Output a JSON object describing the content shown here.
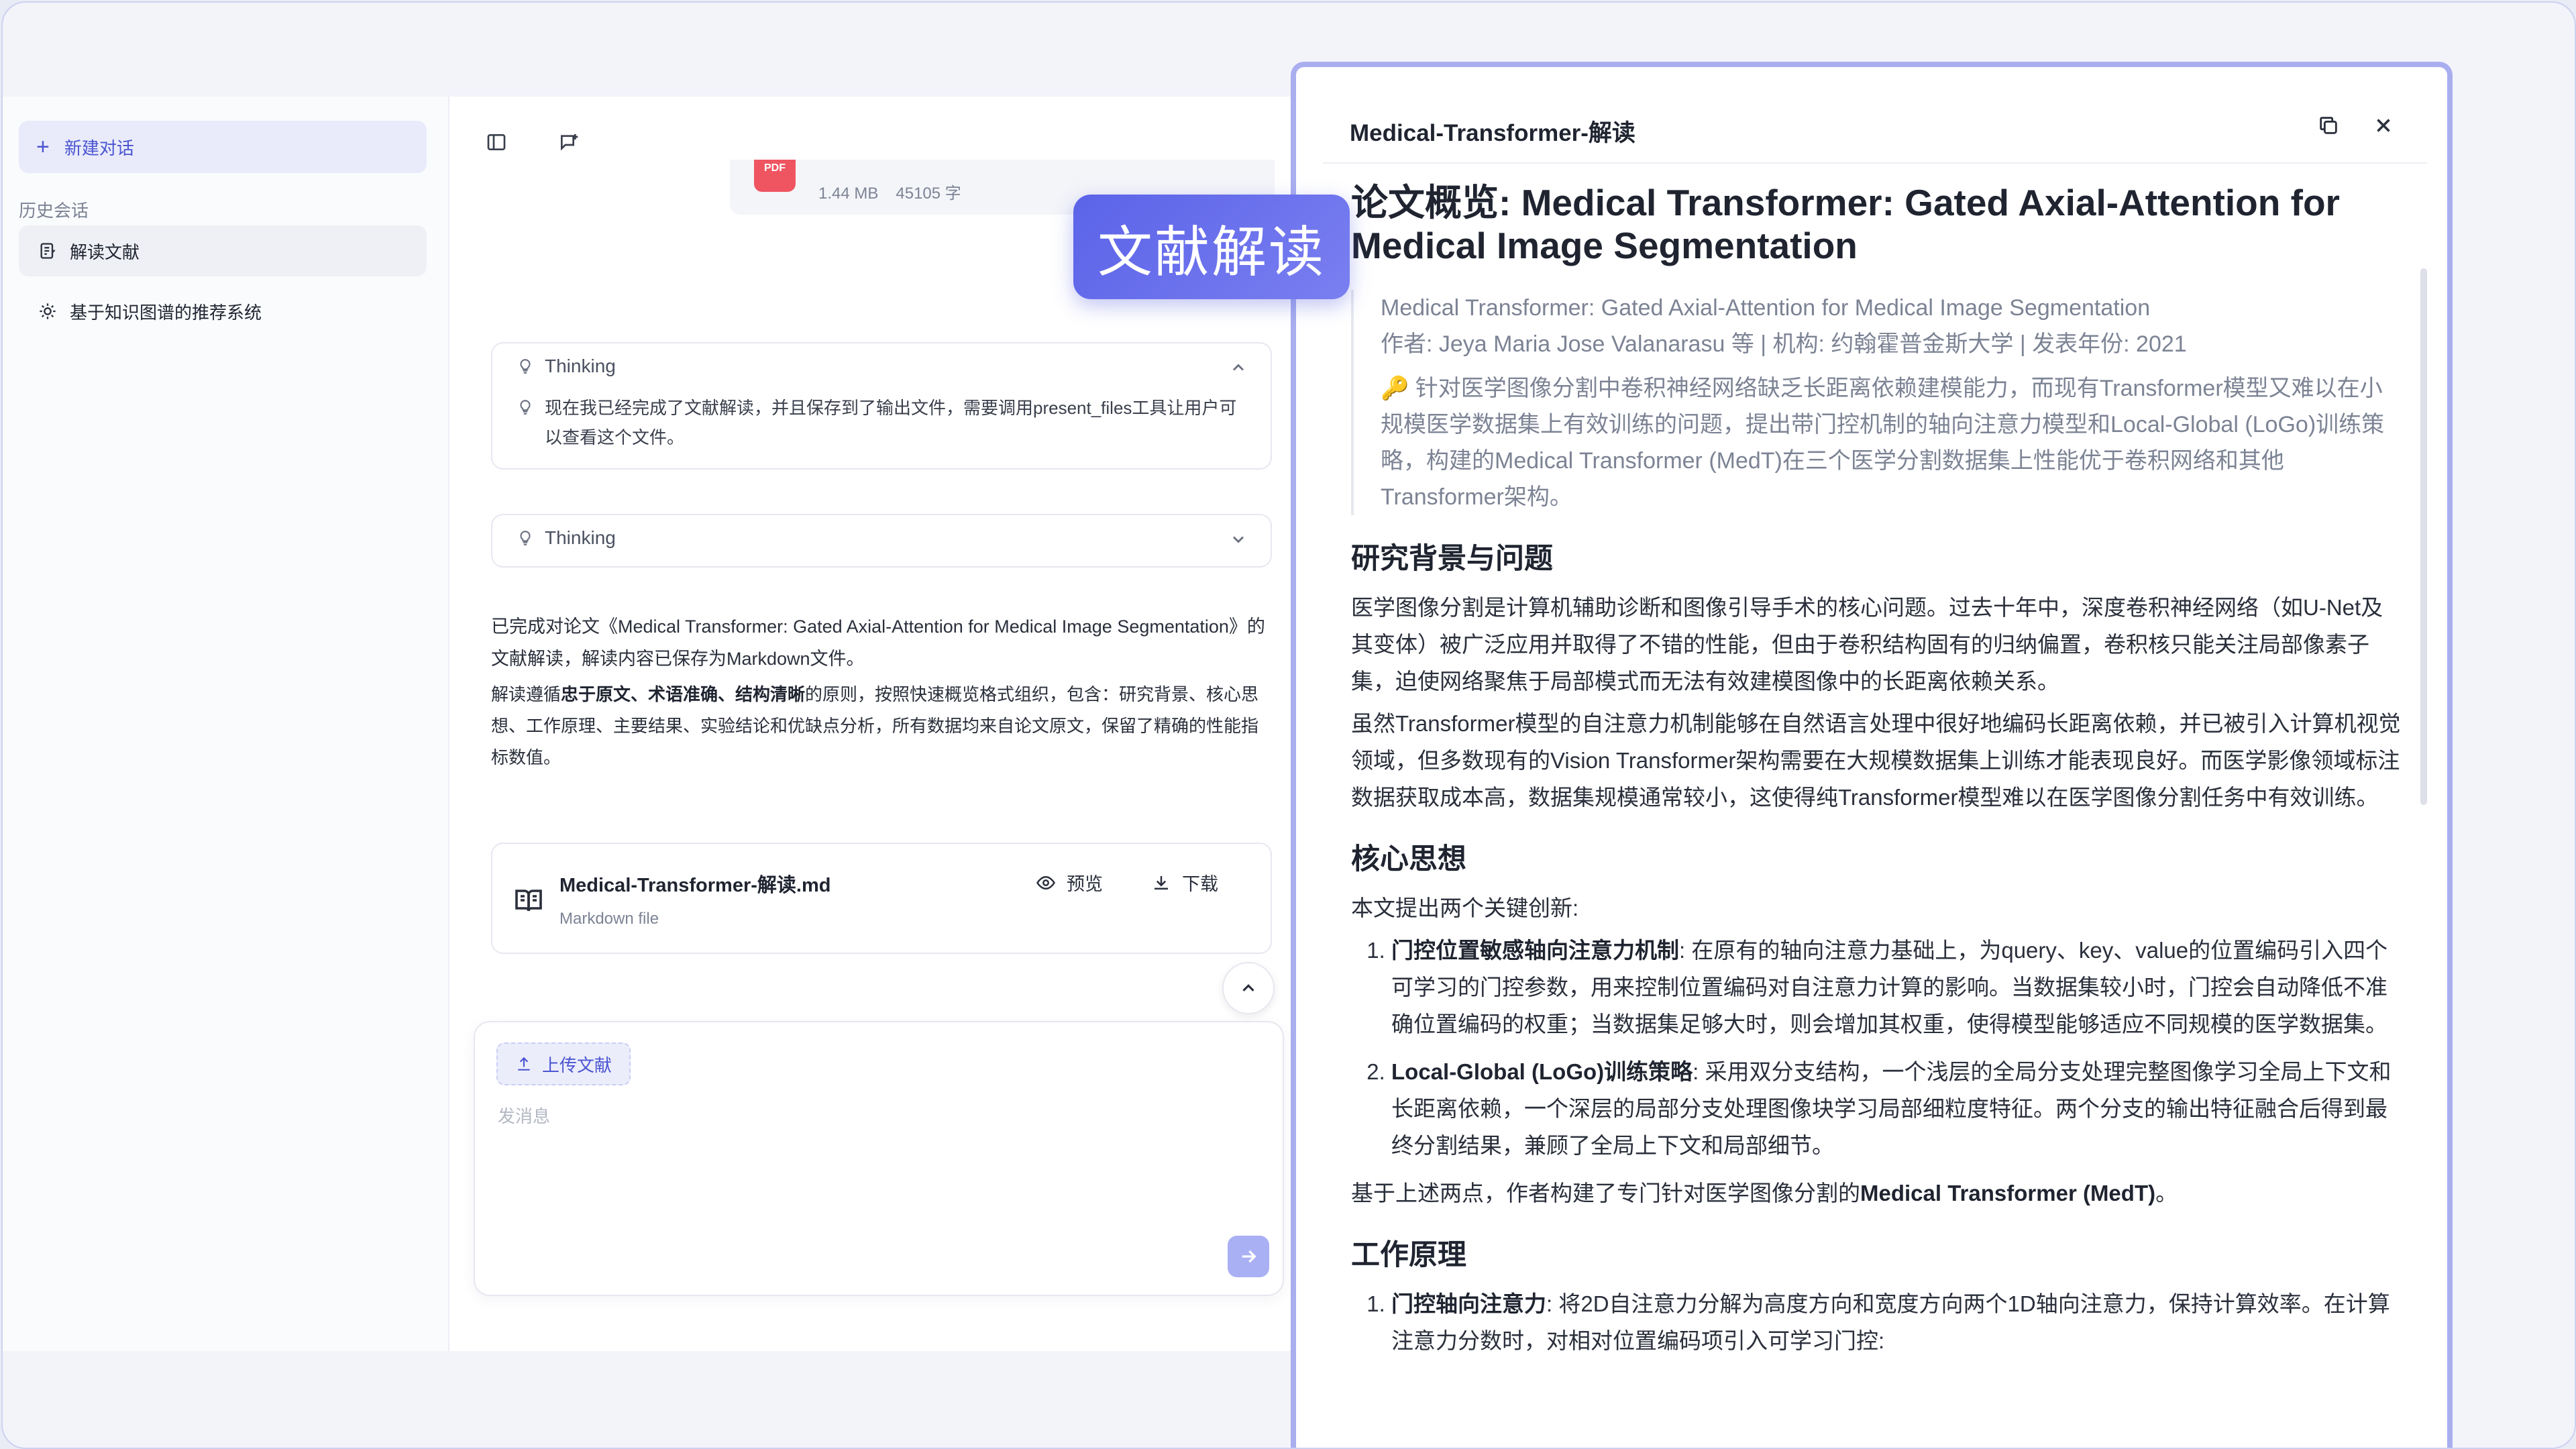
{
  "sidebar": {
    "new_chat": "新建对话",
    "history_label": "历史会话",
    "items": [
      {
        "label": "解读文献",
        "icon": "document-edit-icon"
      },
      {
        "label": "基于知识图谱的推荐系统",
        "icon": "sun-icon"
      }
    ]
  },
  "chat": {
    "attached_file": {
      "badge": "PDF",
      "size": "1.44 MB",
      "chars": "45105 字"
    },
    "thinking_1": {
      "label": "Thinking",
      "text": "现在我已经完成了文献解读，并且保存到了输出文件，需要调用present_files工具让用户可以查看这个文件。"
    },
    "thinking_2": {
      "label": "Thinking"
    },
    "summary_1": "已完成对论文《Medical Transformer: Gated Axial-Attention for Medical Image Segmentation》的文献解读，解读内容已保存为Markdown文件。",
    "summary_2_pre": "解读遵循",
    "summary_2_b1": "忠于原文、术语准确、结构清晰",
    "summary_2_post": "的原则，按照快速概览格式组织，包含：研究背景、核心思想、工作原理、主要结果、实验结论和优缺点分析，所有数据均来自论文原文，保留了精确的性能指标数值。",
    "file_card": {
      "name": "Medical-Transformer-解读.md",
      "type": "Markdown file",
      "preview": "预览",
      "download": "下载"
    },
    "composer": {
      "upload": "上传文献",
      "placeholder": "发消息"
    }
  },
  "badge": "文献解读",
  "panel": {
    "title": "Medical-Transformer-解读",
    "doc_title": "论文概览: Medical Transformer: Gated Axial-Attention for Medical Image Segmentation",
    "quote_title": "Medical Transformer: Gated Axial-Attention for Medical Image Segmentation",
    "quote_meta": "作者: Jeya Maria Jose Valanarasu 等 | 机构: 约翰霍普金斯大学 | 发表年份: 2021",
    "quote_summary": "🔑 针对医学图像分割中卷积神经网络缺乏长距离依赖建模能力，而现有Transformer模型又难以在小规模医学数据集上有效训练的问题，提出带门控机制的轴向注意力模型和Local-Global (LoGo)训练策略，构建的Medical Transformer (MedT)在三个医学分割数据集上性能优于卷积网络和其他Transformer架构。",
    "sections": {
      "background": {
        "heading": "研究背景与问题",
        "p1": "医学图像分割是计算机辅助诊断和图像引导手术的核心问题。过去十年中，深度卷积神经网络（如U-Net及其变体）被广泛应用并取得了不错的性能，但由于卷积结构固有的归纳偏置，卷积核只能关注局部像素子集，迫使网络聚焦于局部模式而无法有效建模图像中的长距离依赖关系。",
        "p2": "虽然Transformer模型的自注意力机制能够在自然语言处理中很好地编码长距离依赖，并已被引入计算机视觉领域，但多数现有的Vision Transformer架构需要在大规模数据集上训练才能表现良好。而医学影像领域标注数据获取成本高，数据集规模通常较小，这使得纯Transformer模型难以在医学图像分割任务中有效训练。"
      },
      "core": {
        "heading": "核心思想",
        "intro": "本文提出两个关键创新:",
        "item1_b": "门控位置敏感轴向注意力机制",
        "item1": ": 在原有的轴向注意力基础上，为query、key、value的位置编码引入四个可学习的门控参数，用来控制位置编码对自注意力计算的影响。当数据集较小时，门控会自动降低不准确位置编码的权重；当数据集足够大时，则会增加其权重，使得模型能够适应不同规模的医学数据集。",
        "item2_b": "Local-Global (LoGo)训练策略",
        "item2": ": 采用双分支结构，一个浅层的全局分支处理完整图像学习全局上下文和长距离依赖，一个深层的局部分支处理图像块学习局部细粒度特征。两个分支的输出特征融合后得到最终分割结果，兼顾了全局上下文和局部细节。",
        "outro_pre": "基于上述两点，作者构建了专门针对医学图像分割的",
        "outro_b": "Medical Transformer (MedT)",
        "outro_post": "。"
      },
      "method": {
        "heading": "工作原理",
        "item1_b": "门控轴向注意力",
        "item1": ": 将2D自注意力分解为高度方向和宽度方向两个1D轴向注意力，保持计算效率。在计算注意力分数时，对相对位置编码项引入可学习门控:"
      }
    }
  }
}
